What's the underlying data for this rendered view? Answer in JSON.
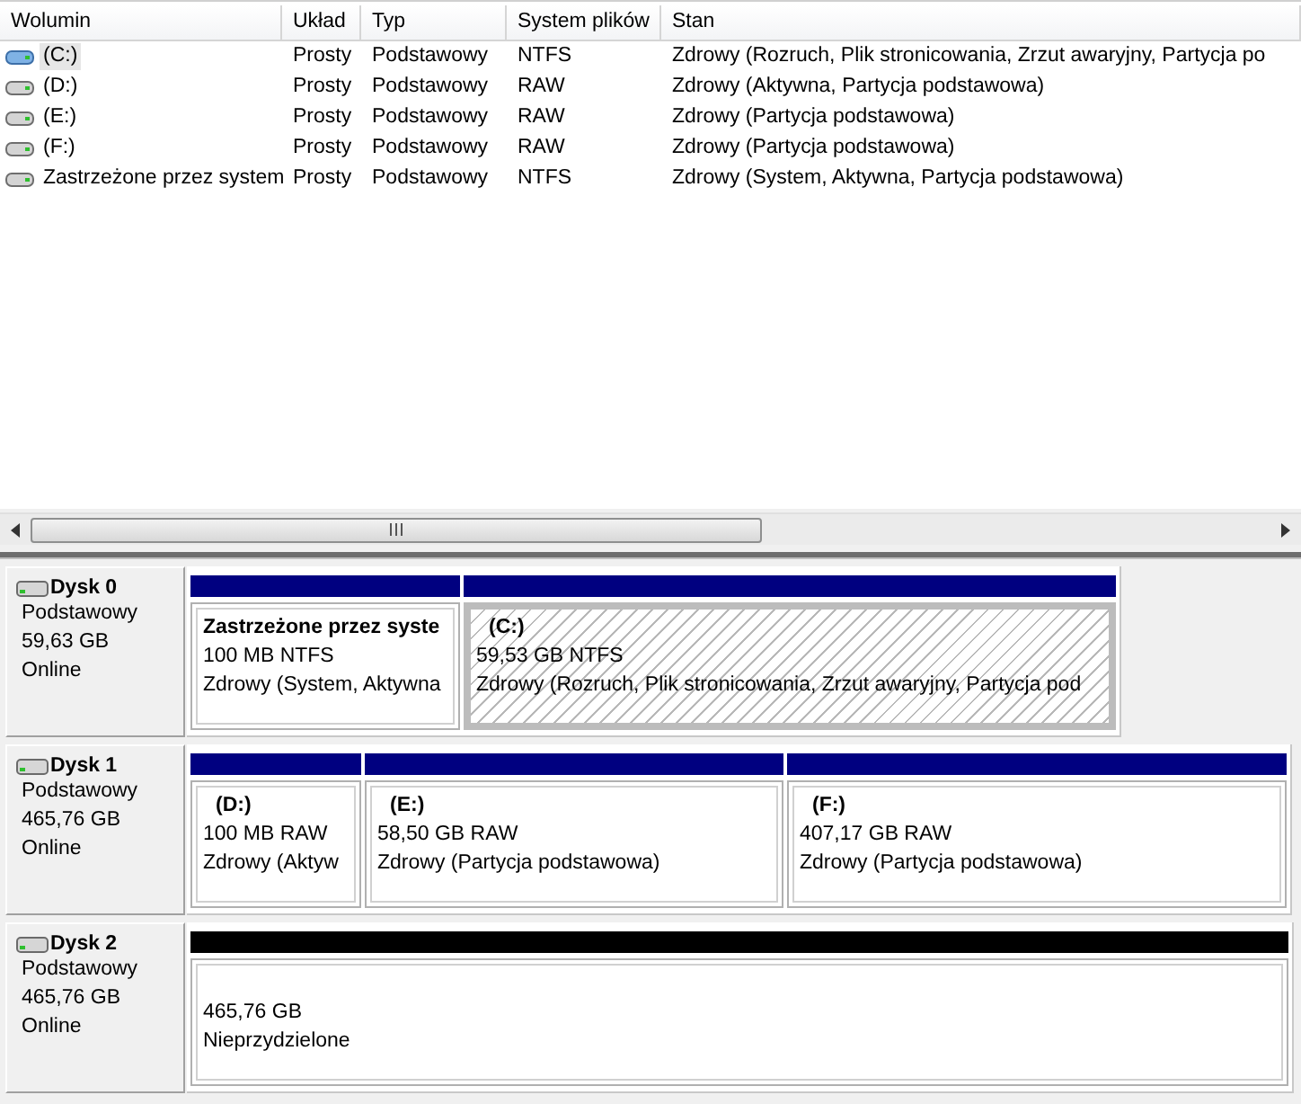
{
  "volume_table": {
    "columns": [
      "Wolumin",
      "Układ",
      "Typ",
      "System plików",
      "Stan"
    ],
    "rows": [
      {
        "kind": "windows",
        "selected": true,
        "cells": [
          "(C:)",
          "Prosty",
          "Podstawowy",
          "NTFS",
          "Zdrowy (Rozruch, Plik stronicowania, Zrzut awaryjny, Partycja po"
        ]
      },
      {
        "kind": "drive",
        "selected": false,
        "cells": [
          "(D:)",
          "Prosty",
          "Podstawowy",
          "RAW",
          "Zdrowy (Aktywna, Partycja podstawowa)"
        ]
      },
      {
        "kind": "drive",
        "selected": false,
        "cells": [
          "(E:)",
          "Prosty",
          "Podstawowy",
          "RAW",
          "Zdrowy (Partycja podstawowa)"
        ]
      },
      {
        "kind": "drive",
        "selected": false,
        "cells": [
          "(F:)",
          "Prosty",
          "Podstawowy",
          "RAW",
          "Zdrowy (Partycja podstawowa)"
        ]
      },
      {
        "kind": "drive",
        "selected": false,
        "cells": [
          "Zastrzeżone przez system",
          "Prosty",
          "Podstawowy",
          "NTFS",
          "Zdrowy (System, Aktywna, Partycja podstawowa)"
        ]
      }
    ]
  },
  "disks": [
    {
      "name": "Dysk 0",
      "type": "Podstawowy",
      "size": "59,63 GB",
      "status": "Online",
      "partitions": [
        {
          "kind": "primary",
          "selected": false,
          "label": "Zastrzeżone przez syste",
          "size": "100 MB NTFS",
          "status": "Zdrowy (System, Aktywna"
        },
        {
          "kind": "primary",
          "selected": true,
          "letter": "(C:)",
          "size": "59,53 GB NTFS",
          "status": "Zdrowy (Rozruch, Plik stronicowania, Zrzut awaryjny, Partycja pod"
        }
      ]
    },
    {
      "name": "Dysk 1",
      "type": "Podstawowy",
      "size": "465,76 GB",
      "status": "Online",
      "partitions": [
        {
          "kind": "primary",
          "selected": false,
          "letter": "(D:)",
          "size": "100 MB RAW",
          "status": "Zdrowy (Aktyw"
        },
        {
          "kind": "primary",
          "selected": false,
          "letter": "(E:)",
          "size": "58,50 GB RAW",
          "status": "Zdrowy (Partycja podstawowa)"
        },
        {
          "kind": "primary",
          "selected": false,
          "letter": "(F:)",
          "size": "407,17 GB RAW",
          "status": "Zdrowy (Partycja podstawowa)"
        }
      ]
    },
    {
      "name": "Dysk 2",
      "type": "Podstawowy",
      "size": "465,76 GB",
      "status": "Online",
      "partitions": [
        {
          "kind": "unallocated",
          "selected": false,
          "size": "465,76 GB",
          "status": "Nieprzydzielone"
        }
      ]
    }
  ]
}
